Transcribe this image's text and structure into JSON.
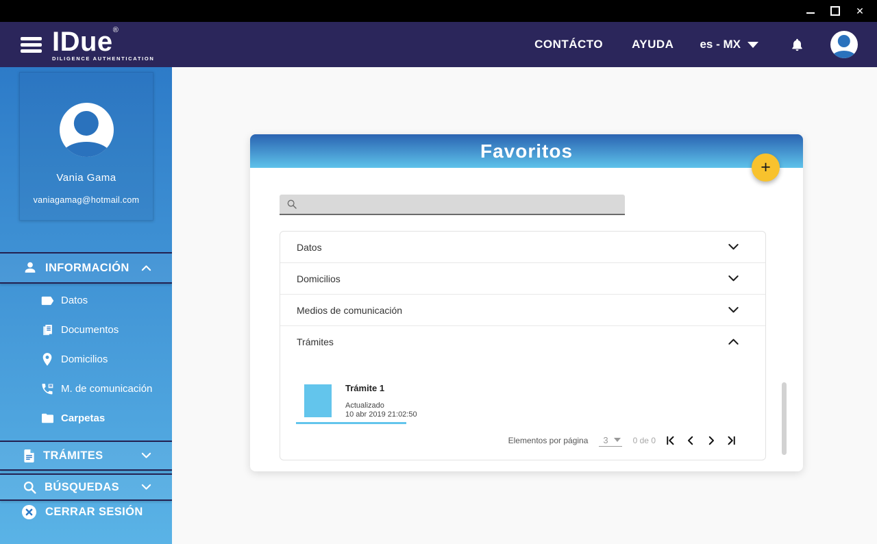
{
  "window": {
    "title_bar": {
      "close_glyph": "✕"
    }
  },
  "header": {
    "logo": {
      "name": "IDue",
      "registered": "®",
      "tagline": "DILIGENCE AUTHENTICATION"
    },
    "nav": [
      {
        "label": "CONTÁCTO"
      },
      {
        "label": "AYUDA"
      }
    ],
    "language": {
      "value": "es - MX"
    }
  },
  "sidebar": {
    "profile": {
      "name": "Vania Gama",
      "email": "vaniagamag@hotmail.com"
    },
    "sections": [
      {
        "label": "INFORMACIÓN",
        "icon": "person-icon",
        "state": "expanded",
        "items": [
          {
            "label": "Datos",
            "icon": "label-icon"
          },
          {
            "label": "Documentos",
            "icon": "documents-icon"
          },
          {
            "label": "Domicilios",
            "icon": "map-pin-icon"
          },
          {
            "label": "M. de comunicación",
            "icon": "phone-icon"
          },
          {
            "label": "Carpetas",
            "icon": "folder-icon",
            "active": true
          }
        ]
      },
      {
        "label": "TRÁMITES",
        "icon": "document-icon",
        "state": "collapsed"
      },
      {
        "label": "BÚSQUEDAS",
        "icon": "search-icon",
        "state": "collapsed"
      }
    ],
    "logout": {
      "label": "CERRAR SESIÓN",
      "icon": "close-circle-icon"
    }
  },
  "main": {
    "card": {
      "title": "Favoritos",
      "fab_glyph": "+",
      "search": {
        "value": "",
        "placeholder": ""
      },
      "accordion": [
        {
          "label": "Datos",
          "state": "collapsed"
        },
        {
          "label": "Domicilios",
          "state": "collapsed"
        },
        {
          "label": "Medios de comunicación",
          "state": "collapsed"
        },
        {
          "label": "Trámites",
          "state": "expanded",
          "items": [
            {
              "title": "Trámite 1",
              "status": "Actualizado",
              "date": "10 abr 2019 21:02:50"
            }
          ]
        }
      ],
      "pagination": {
        "label": "Elementos por página",
        "page_size": "3",
        "range": "0 de 0"
      }
    }
  },
  "colors": {
    "titlebar": "#000000",
    "appbar_navy": "#2b265b",
    "sidebar_top": "#2d7bc8",
    "sidebar_bottom": "#5ab3e6",
    "card_header_top": "#2a63b1",
    "card_header_bottom": "#5ec2ea",
    "fab_yellow": "#f8c22d",
    "thumbnail_blue": "#63c5ec"
  }
}
